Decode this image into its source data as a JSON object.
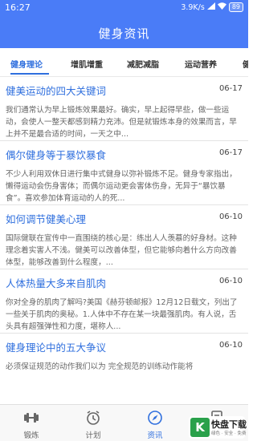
{
  "status_bar": {
    "time": "16:27",
    "network_speed": "3.9K/s",
    "battery": "89"
  },
  "app": {
    "title": "健身资讯",
    "accent_color": "#4a7cf7"
  },
  "tabs": [
    {
      "label": "健身理论",
      "active": true
    },
    {
      "label": "增肌增重",
      "active": false
    },
    {
      "label": "减肥减脂",
      "active": false
    },
    {
      "label": "运动营养",
      "active": false
    },
    {
      "label": "健",
      "active": false
    }
  ],
  "articles": [
    {
      "title": "健美运动的四大关键词",
      "date": "06-17",
      "summary": "我们通常认为早上锻炼效果最好。确实，早上起得早些，做一些运动，会使人一整天都感到精力充沛。但是就锻炼本身的效果而言，早上并不是最合适的时间，一天之中..."
    },
    {
      "title": "偶尔健身等于暴饮暴食",
      "date": "06-17",
      "summary": "不少人利用双休日进行集中式健身以弥补锻炼不足。健身专家指出，懒得运动会伤身害体；而偶尔运动更会害体伤身，无异于“暴饮暴食”。喜欢参加体育运动的人的死..."
    },
    {
      "title": "如何调节健美心理",
      "date": "06-10",
      "summary": "国际健联在宣传中一直围绕的核心是：练出人人羡慕的好身材。这种理念着实害人不浅。健美可以改善体型，但它能够向着什么方向改善体型，能够改善到什么程度，..."
    },
    {
      "title": "人体热量大多来自肌肉",
      "date": "06-10",
      "summary": "你对全身的肌肉了解吗?美国《赫芬顿邮报》12月12日载文，列出了一些关于肌肉的奥秘。1.人体中不存在某一块最强肌肉。有人说，舌头具有超强弹性和力度，堪称人..."
    },
    {
      "title": "健身理论中的五大争议",
      "date": "06-10",
      "summary": "必须保证规范的动作我们以为 完全规范的训练动作能将"
    }
  ],
  "bottom_nav": [
    {
      "label": "锻炼",
      "icon": "dumbbell-icon",
      "active": false
    },
    {
      "label": "计划",
      "icon": "alarm-clock-icon",
      "active": false
    },
    {
      "label": "资讯",
      "icon": "compass-icon",
      "active": true
    },
    {
      "label": "",
      "icon": "document-icon",
      "active": false
    }
  ],
  "watermark": {
    "logo_letter": "K",
    "name": "快盘下载",
    "tagline": "绿色 · 安全 · 免费"
  }
}
